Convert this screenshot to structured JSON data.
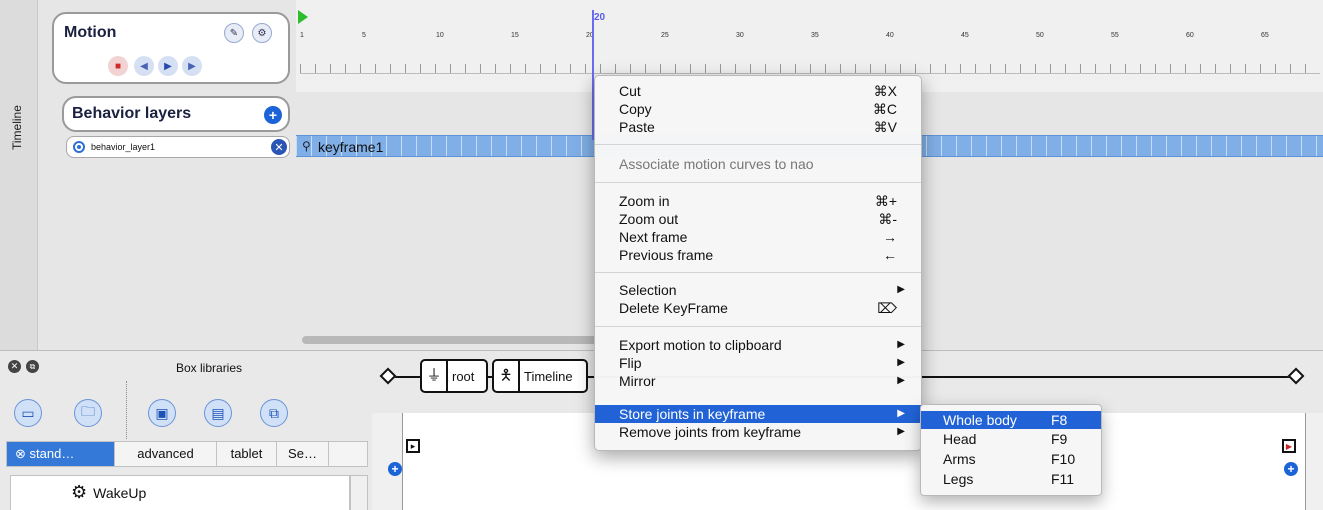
{
  "side_tab": {
    "label": "Timeline"
  },
  "motion": {
    "title": "Motion",
    "icons": [
      "pencil-icon",
      "wrench-icon",
      "stop-icon",
      "step-back-icon",
      "play-icon",
      "step-forward-icon"
    ]
  },
  "behavior_layers": {
    "title": "Behavior layers",
    "add_label": "+",
    "layers": [
      {
        "name": "behavior_layer1"
      }
    ]
  },
  "timeline": {
    "start_label": "1",
    "ticks": [
      "1",
      "5",
      "10",
      "15",
      "20",
      "25",
      "30",
      "35",
      "40",
      "45",
      "50",
      "55",
      "60",
      "65"
    ],
    "cursor_frame": "20",
    "keyframe": "keyframe1"
  },
  "box_libraries": {
    "title": "Box libraries",
    "tabs": [
      "stand…",
      "advanced",
      "tablet",
      "Se…"
    ],
    "items": [
      {
        "label": "WakeUp"
      }
    ]
  },
  "flow": {
    "breadcrumbs": [
      "root",
      "Timeline"
    ]
  },
  "context_menu": {
    "items": [
      {
        "label": "Cut",
        "shortcut": "⌘X"
      },
      {
        "label": "Copy",
        "shortcut": "⌘C"
      },
      {
        "label": "Paste",
        "shortcut": "⌘V"
      },
      {
        "label": "Associate motion curves to nao",
        "shortcut": ""
      },
      {
        "label": "Zoom in",
        "shortcut": "⌘+"
      },
      {
        "label": "Zoom out",
        "shortcut": "⌘-"
      },
      {
        "label": "Next frame",
        "shortcut": "→"
      },
      {
        "label": "Previous frame",
        "shortcut": "←"
      },
      {
        "label": "Selection",
        "shortcut": "▶"
      },
      {
        "label": "Delete KeyFrame",
        "shortcut": "⌦"
      },
      {
        "label": "Export motion to clipboard",
        "shortcut": "▶"
      },
      {
        "label": "Flip",
        "shortcut": "▶"
      },
      {
        "label": "Mirror",
        "shortcut": "▶"
      },
      {
        "label": "Store joints in keyframe",
        "shortcut": "▶"
      },
      {
        "label": "Remove joints from keyframe",
        "shortcut": "▶"
      }
    ]
  },
  "submenu": {
    "items": [
      {
        "label": "Whole body",
        "shortcut": "F8"
      },
      {
        "label": "Head",
        "shortcut": "F9"
      },
      {
        "label": "Arms",
        "shortcut": "F10"
      },
      {
        "label": "Legs",
        "shortcut": "F11"
      }
    ]
  },
  "colors": {
    "accent": "#2163d6",
    "keyframe_bar": "#80aee6",
    "cursor": "#6b6bf0",
    "start_marker": "#2dbd2d"
  }
}
